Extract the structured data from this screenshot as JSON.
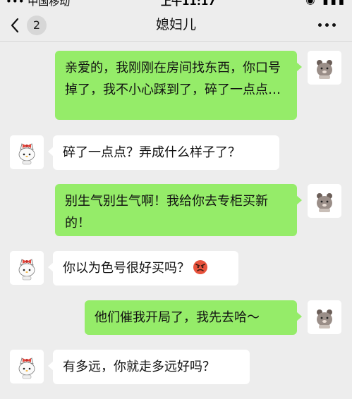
{
  "statusbar": {
    "carrier": "••• 中国移动 ",
    "time": "上午11:17",
    "icons": "◉ ▮▮▮"
  },
  "header": {
    "back_count": "2",
    "title": "媳妇儿",
    "more_label": "更多"
  },
  "messages": [
    {
      "side": "right",
      "text": "亲爱的，我刚刚在房间找东西，你口号掉了，我不小心踩到了，碎了一点点…"
    },
    {
      "side": "left",
      "text": "碎了一点点？弄成什么样子了？"
    },
    {
      "side": "right",
      "text": "别生气别生气啊！我给你去专柜买新的！"
    },
    {
      "side": "left",
      "text": "你以为色号很好买吗？",
      "emoji": "angry-face"
    },
    {
      "side": "right",
      "text": "他们催我开局了，我先去哈～"
    },
    {
      "side": "left",
      "text": "有多远，你就走多远好吗？"
    }
  ],
  "colors": {
    "background": "#ededed",
    "sent_bubble": "#95ec69",
    "received_bubble": "#ffffff",
    "badge": "#d7d7d7"
  },
  "icons": {
    "back": "chevron-left-icon",
    "more": "more-dots-icon",
    "sender_avatar": "bear-avatar",
    "receiver_avatar": "cat-with-bow-avatar",
    "emoji": "angry-face-emoji"
  }
}
